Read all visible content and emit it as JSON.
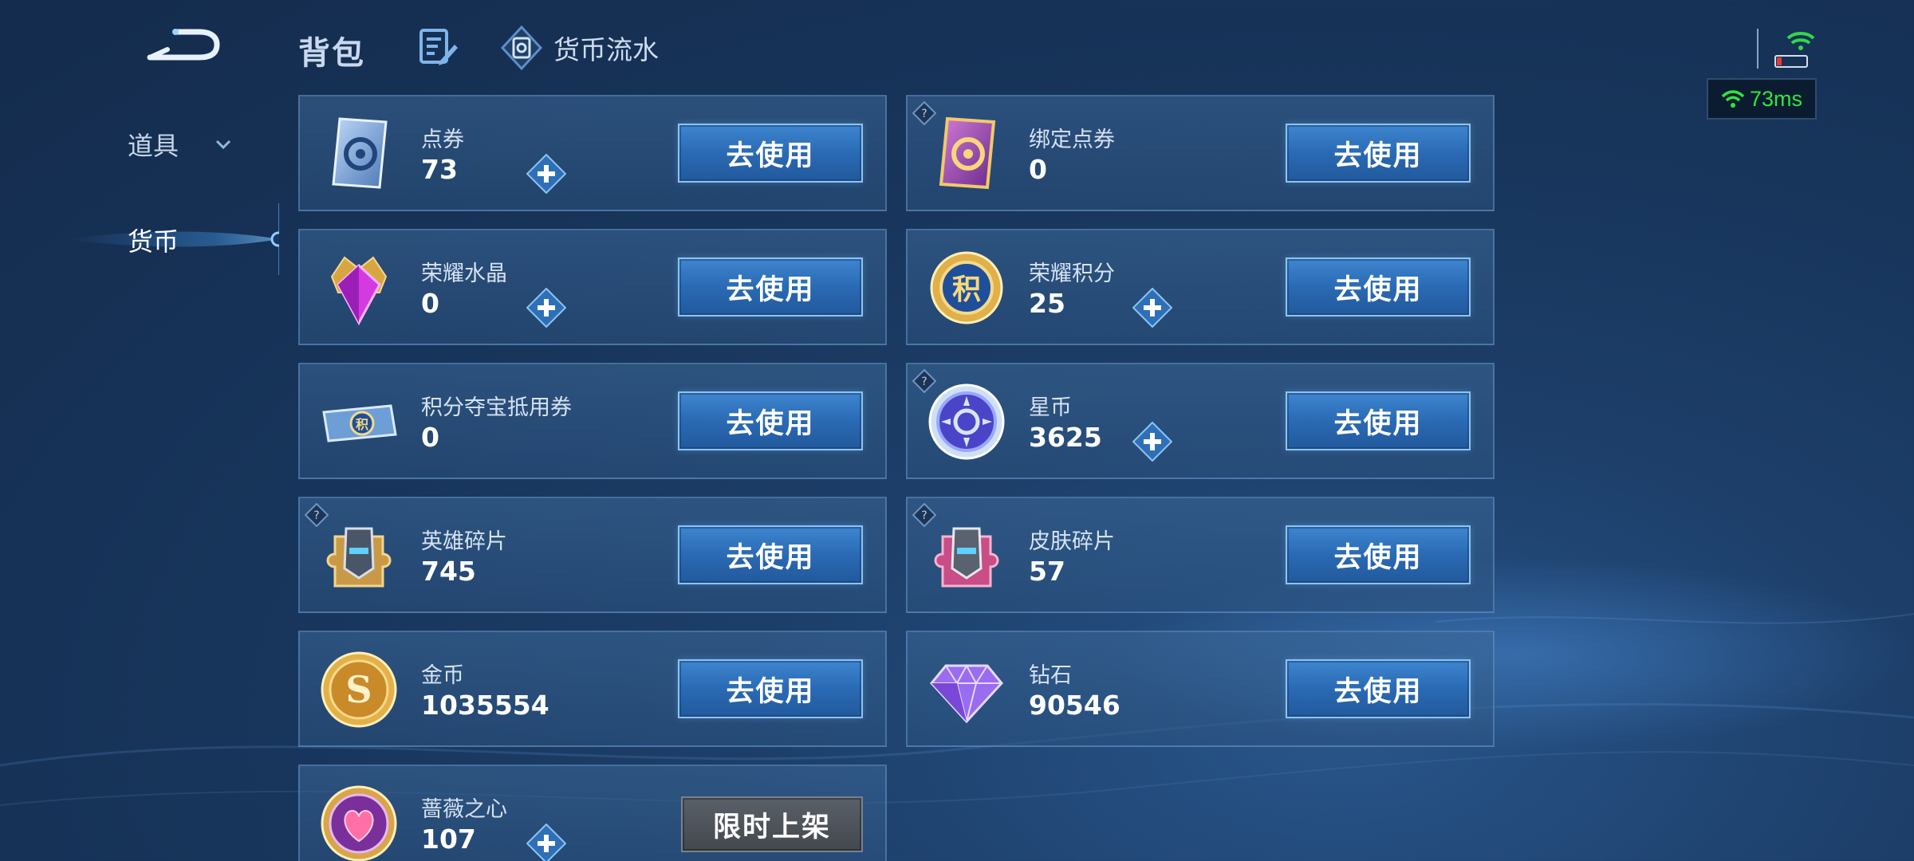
{
  "header": {
    "title": "背包",
    "flow_label": "货币流水"
  },
  "sidebar": {
    "items": [
      {
        "label": "道具"
      },
      {
        "label": "货币"
      }
    ]
  },
  "status": {
    "ping": "73ms"
  },
  "cards": [
    {
      "name": "点券",
      "value": "73",
      "button": "去使用"
    },
    {
      "name": "绑定点券",
      "value": "0",
      "button": "去使用"
    },
    {
      "name": "荣耀水晶",
      "value": "0",
      "button": "去使用"
    },
    {
      "name": "荣耀积分",
      "value": "25",
      "button": "去使用"
    },
    {
      "name": "积分夺宝抵用券",
      "value": "0",
      "button": "去使用"
    },
    {
      "name": "星币",
      "value": "3625",
      "button": "去使用"
    },
    {
      "name": "英雄碎片",
      "value": "745",
      "button": "去使用"
    },
    {
      "name": "皮肤碎片",
      "value": "57",
      "button": "去使用"
    },
    {
      "name": "金币",
      "value": "1035554",
      "button": "去使用"
    },
    {
      "name": "钻石",
      "value": "90546",
      "button": "去使用"
    },
    {
      "name": "蔷薇之心",
      "value": "107",
      "button": "限时上架"
    }
  ],
  "icon_names": {
    "ticket": "ticket-icon",
    "bound_ticket": "bound-ticket-icon",
    "crystal": "crystal-icon",
    "honor_points": "honor-points-icon",
    "voucher": "voucher-icon",
    "star_coin": "star-coin-icon",
    "hero_shard": "hero-shard-icon",
    "skin_shard": "skin-shard-icon",
    "gold_coin": "gold-coin-icon",
    "diamond": "diamond-icon",
    "rose_heart": "rose-heart-icon"
  },
  "colors": {
    "button_blue": "#2a6ab4",
    "button_gray": "#4a4f55",
    "ping_green": "#2fe640",
    "plus_blue": "#2f6fb5"
  }
}
